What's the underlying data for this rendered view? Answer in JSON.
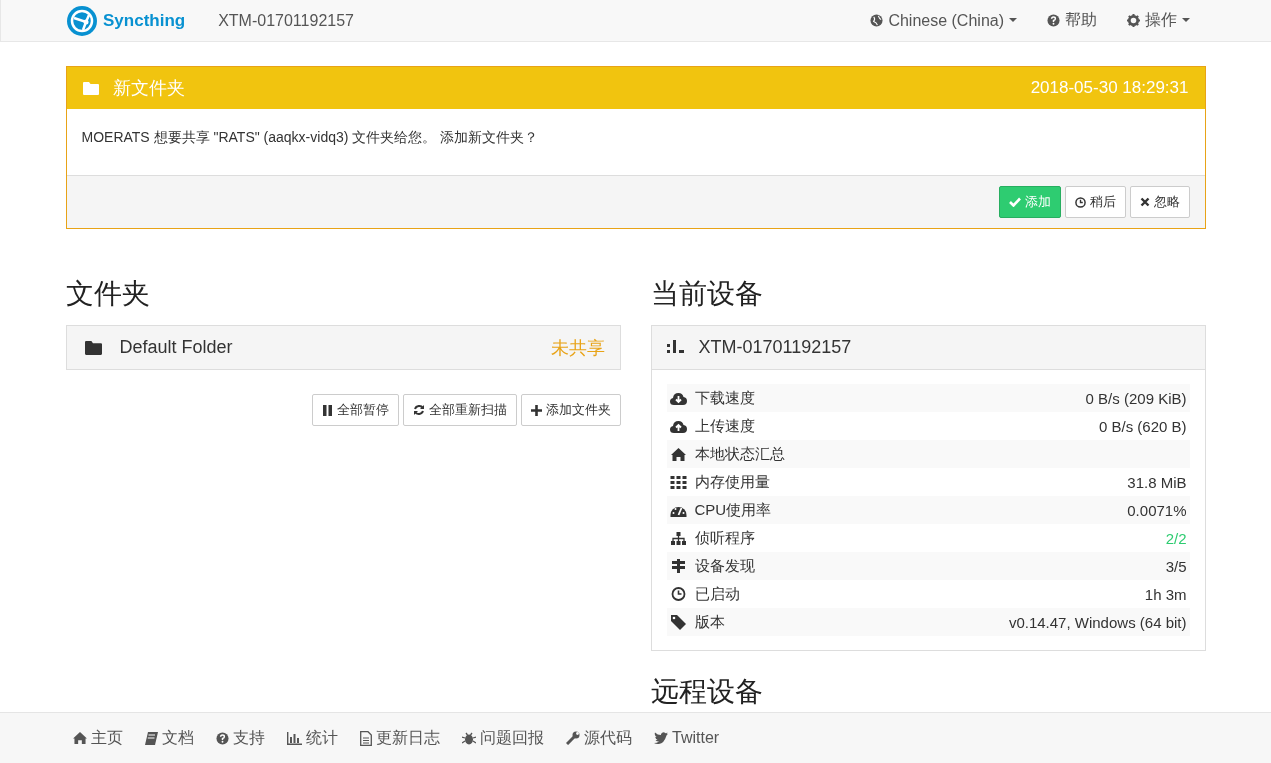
{
  "navbar": {
    "brand": "Syncthing",
    "device": "XTM-01701192157",
    "menus": [
      {
        "label": "Chinese (China)",
        "dropdown": true
      },
      {
        "label": "帮助",
        "dropdown": false
      },
      {
        "label": "操作",
        "dropdown": true
      }
    ]
  },
  "notice": {
    "title": "新文件夹",
    "time": "2018-05-30 18:29:31",
    "message": "MOERATS 想要共享 \"RATS\" (aaqkx-vidq3) 文件夹给您。 添加新文件夹？",
    "buttons": [
      {
        "label": "添加",
        "kind": "primary"
      },
      {
        "label": "稍后",
        "kind": "later"
      },
      {
        "label": "忽略",
        "kind": "ignore"
      }
    ]
  },
  "folders": {
    "heading": "文件夹",
    "items": [
      {
        "name": "Default Folder",
        "status": "未共享"
      }
    ],
    "buttons": [
      {
        "label": "全部暂停",
        "kind": "pause"
      },
      {
        "label": "全部重新扫描",
        "kind": "rescan"
      },
      {
        "label": "添加文件夹",
        "kind": "add"
      }
    ]
  },
  "this_device": {
    "heading": "当前设备",
    "name": "XTM-01701192157",
    "stats": [
      {
        "label": "下载速度",
        "value": "0 B/s (209 KiB)"
      },
      {
        "label": "上传速度",
        "value": "0 B/s (620 B)"
      },
      {
        "label": "本地状态汇总"
      },
      {
        "label": "内存使用量",
        "value": "31.8 MiB"
      },
      {
        "label": "CPU使用率",
        "value": "0.0071%"
      },
      {
        "label": "侦听程序",
        "value": "2/2",
        "color": "#2ecc71"
      },
      {
        "label": "设备发现",
        "value": "3/5"
      },
      {
        "label": "已启动",
        "value": "1h 3m"
      },
      {
        "label": "版本",
        "value": "v0.14.47, Windows (64 bit)"
      }
    ]
  },
  "remote_devices": {
    "heading": "远程设备"
  },
  "footer": {
    "links": [
      "主页",
      "文档",
      "支持",
      "统计",
      "更新日志",
      "问题回报",
      "源代码",
      "Twitter"
    ]
  }
}
